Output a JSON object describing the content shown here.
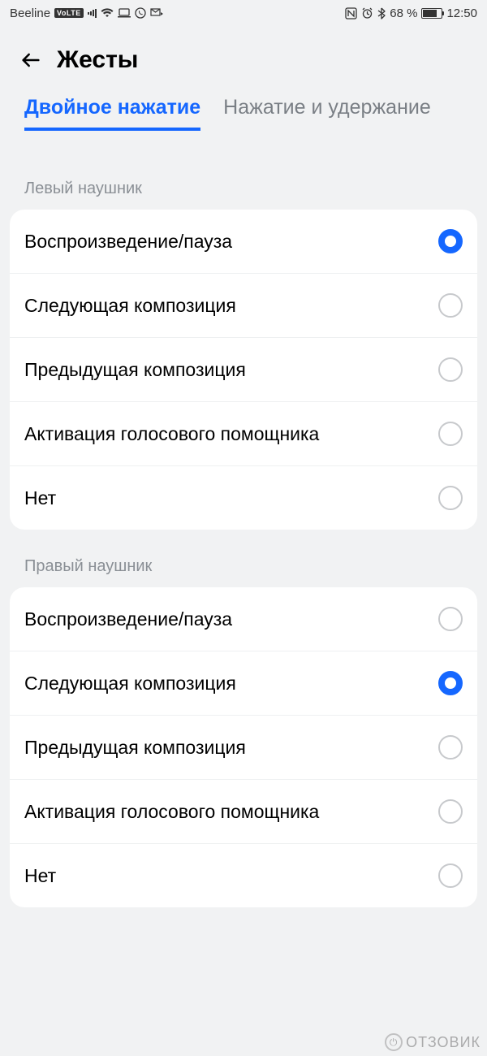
{
  "status": {
    "carrier": "Beeline",
    "volte": "VoLTE",
    "battery_text": "68 %",
    "time": "12:50"
  },
  "header": {
    "title": "Жесты"
  },
  "tabs": {
    "active": "Двойное нажатие",
    "inactive": "Нажатие и удержание"
  },
  "sections": {
    "left": {
      "label": "Левый наушник",
      "options": [
        "Воспроизведение/пауза",
        "Следующая композиция",
        "Предыдущая композиция",
        "Активация голосового помощника",
        "Нет"
      ],
      "selected_index": 0
    },
    "right": {
      "label": "Правый наушник",
      "options": [
        "Воспроизведение/пауза",
        "Следующая композиция",
        "Предыдущая композиция",
        "Активация голосового помощника",
        "Нет"
      ],
      "selected_index": 1
    }
  },
  "watermark": "ОТЗОВИК"
}
